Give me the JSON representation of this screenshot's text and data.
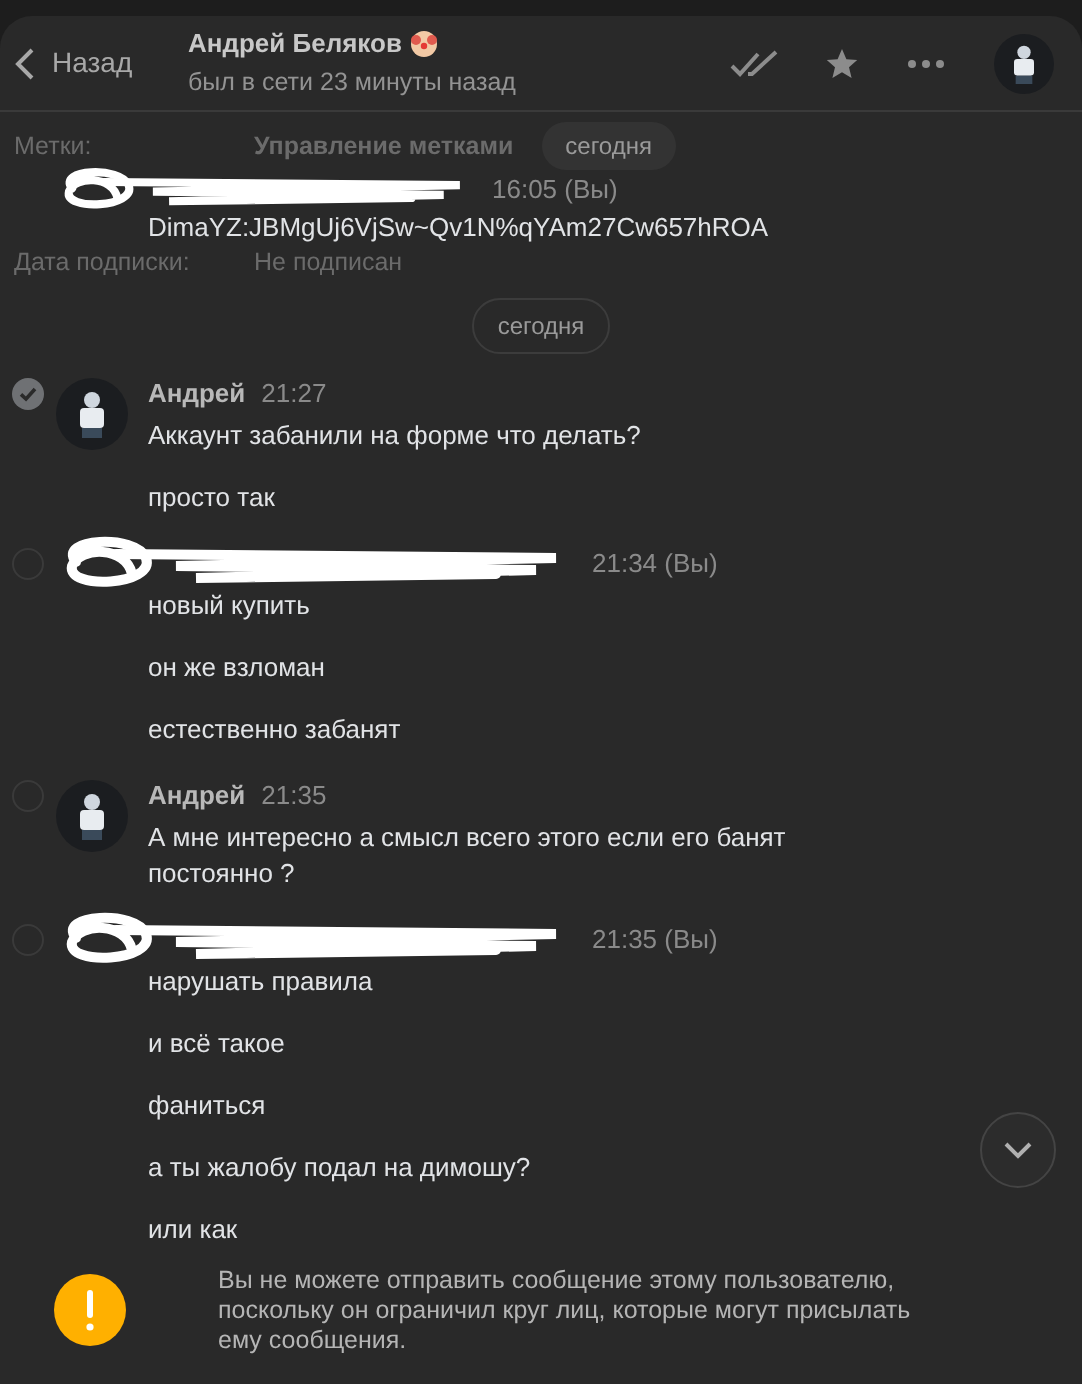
{
  "header": {
    "back": "Назад",
    "name": "Андрей Беляков",
    "status": "был в сети 23 минуты назад"
  },
  "profile": [
    {
      "label": "Метки:",
      "value": "Управление метками"
    },
    {
      "label": "Дата подписки:",
      "value": "Не подписан"
    }
  ],
  "floating_date": "сегодня",
  "first_message": {
    "time": "16:05 (Вы)",
    "text": "DimaYZ:JBMgUj6VjSw~Qv1N%qYAm27Cw657hROA"
  },
  "date_divider": "сегодня",
  "groups": [
    {
      "kind": "incoming",
      "selected": true,
      "author": "Андрей",
      "time": "21:27",
      "lines": [
        "Аккаунт забанили на форме что делать?",
        "просто так"
      ]
    },
    {
      "kind": "outgoing",
      "selected": false,
      "time": "21:34 (Вы)",
      "lines": [
        "новый купить",
        "он же взломан",
        "естественно забанят"
      ]
    },
    {
      "kind": "incoming",
      "selected": false,
      "author": "Андрей",
      "time": "21:35",
      "lines": [
        "А мне интересно а смысл всего этого если его банят постоянно ?"
      ]
    },
    {
      "kind": "outgoing",
      "selected": false,
      "time": "21:35 (Вы)",
      "lines": [
        "нарушать правила",
        "и всё такое",
        "фаниться",
        "а ты жалобу подал на димошу?",
        "или как"
      ]
    }
  ],
  "notice": "Вы не можете отправить сообщение этому пользователю, поскольку он ограничил круг лиц, которые могут присылать ему сообщения."
}
